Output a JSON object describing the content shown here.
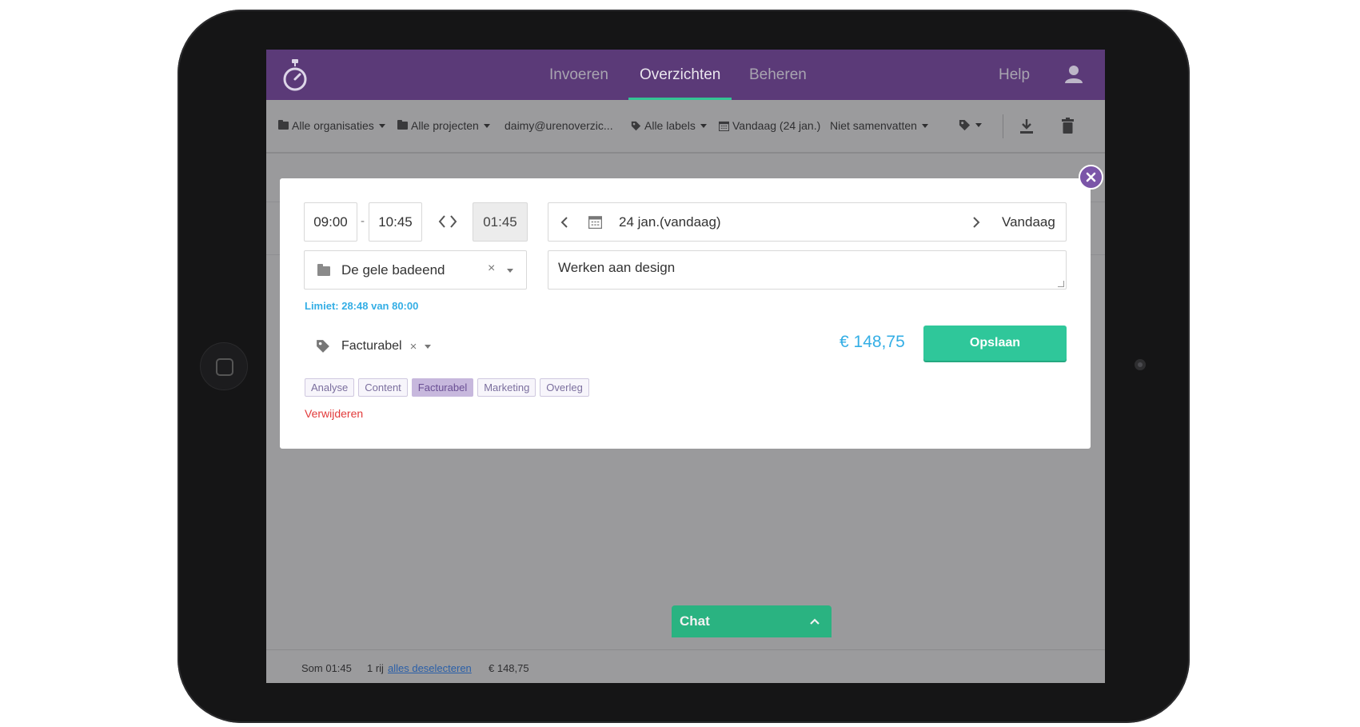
{
  "nav": {
    "tabs": [
      "Invoeren",
      "Overzichten",
      "Beheren"
    ],
    "active_tab": "Overzichten",
    "help": "Help",
    "logo_icon": "stopwatch-icon",
    "user_icon": "user-icon"
  },
  "toolbar": {
    "organisations": "Alle organisaties",
    "projects": "Alle projecten",
    "user": "daimy@urenoverzic...",
    "labels": "Alle labels",
    "date": "Vandaag (24 jan.)",
    "summarize": "Niet samenvatten",
    "tag_icon": "tag-icon",
    "download_icon": "download-icon",
    "trash_icon": "trash-icon"
  },
  "modal": {
    "start_time": "09:00",
    "separator": "-",
    "end_time": "10:45",
    "duration": "01:45",
    "date": "24 jan.(vandaag)",
    "today_button": "Vandaag",
    "project": "De gele badeend",
    "project_clear": "×",
    "description": "Werken aan design",
    "limit": "Limiet: 28:48 van 80:00",
    "tag": "Facturabel",
    "tag_clear": "×",
    "price": "€ 148,75",
    "save": "Opslaan",
    "chips": [
      "Analyse",
      "Content",
      "Facturabel",
      "Marketing",
      "Overleg"
    ],
    "selected_chip": "Facturabel",
    "delete": "Verwijderen",
    "close_icon": "close-icon"
  },
  "status": {
    "sum": "Som 01:45",
    "rows": "1 rij",
    "deselect": "alles deselecteren",
    "total": "€ 148,75"
  },
  "chat": {
    "label": "Chat"
  },
  "colors": {
    "nav_bg": "#5b3a78",
    "accent_green": "#2fc79a",
    "price_blue": "#34aee5",
    "delete_red": "#e23b3b",
    "close_purple": "#7b55a8"
  }
}
